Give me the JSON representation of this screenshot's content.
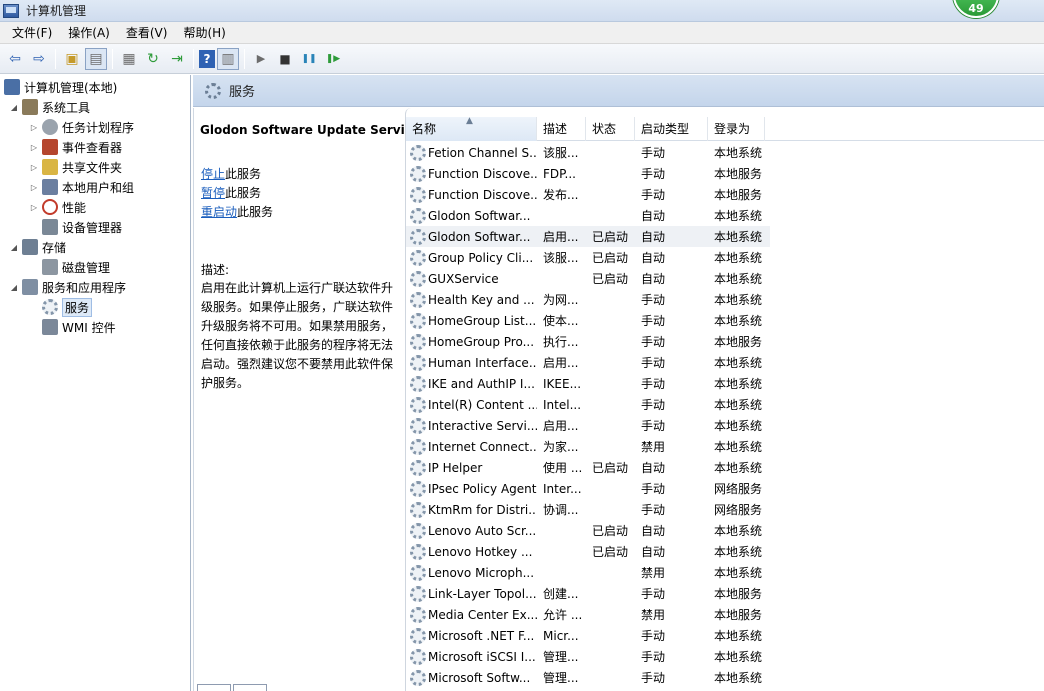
{
  "window": {
    "title": "计算机管理",
    "badge": "49"
  },
  "menu": [
    "文件(F)",
    "操作(A)",
    "查看(V)",
    "帮助(H)"
  ],
  "toolbar": [
    {
      "icon": "back-arrow-icon",
      "glyph": "⇦"
    },
    {
      "icon": "forward-arrow-icon",
      "glyph": "⇨"
    },
    {
      "icon": "folder-up-icon",
      "glyph": "▣"
    },
    {
      "icon": "console-tree-icon",
      "glyph": "▤"
    },
    {
      "icon": "properties-icon",
      "glyph": "▦"
    },
    {
      "icon": "refresh-icon",
      "glyph": "↻"
    },
    {
      "icon": "export-list-icon",
      "glyph": "⇥"
    },
    {
      "icon": "help-icon",
      "glyph": "?"
    },
    {
      "icon": "action-pane-icon",
      "glyph": "▥"
    },
    {
      "icon": "start-service-icon",
      "glyph": "▶"
    },
    {
      "icon": "stop-service-icon",
      "glyph": "■"
    },
    {
      "icon": "pause-service-icon",
      "glyph": "❚❚"
    },
    {
      "icon": "restart-service-icon",
      "glyph": "❚▶"
    }
  ],
  "tree": [
    {
      "label": "计算机管理(本地)",
      "icon": "computer-management-icon",
      "color": "#4a6fa5",
      "arrow": ""
    },
    {
      "label": "系统工具",
      "icon": "system-tools-icon",
      "color": "#8a7a5a",
      "arrow": "◢"
    },
    {
      "label": "任务计划程序",
      "icon": "task-scheduler-icon",
      "color": "#9aa3ad",
      "arrow": "▷"
    },
    {
      "label": "事件查看器",
      "icon": "event-viewer-icon",
      "color": "#b5462e",
      "arrow": "▷"
    },
    {
      "label": "共享文件夹",
      "icon": "shared-folders-icon",
      "color": "#d9b544",
      "arrow": "▷"
    },
    {
      "label": "本地用户和组",
      "icon": "local-users-groups-icon",
      "color": "#6b7fa0",
      "arrow": "▷"
    },
    {
      "label": "性能",
      "icon": "performance-icon",
      "color": "#c23b2b",
      "arrow": "▷"
    },
    {
      "label": "设备管理器",
      "icon": "device-manager-icon",
      "color": "#7a8896",
      "arrow": ""
    },
    {
      "label": "存储",
      "icon": "storage-icon",
      "color": "#6e7f93",
      "arrow": "◢"
    },
    {
      "label": "磁盘管理",
      "icon": "disk-management-icon",
      "color": "#8c96a1",
      "arrow": ""
    },
    {
      "label": "服务和应用程序",
      "icon": "services-applications-icon",
      "color": "#7f8fa3",
      "arrow": "◢"
    },
    {
      "label": "服务",
      "icon": "services-gear-icon",
      "color": "#9aa8b8",
      "arrow": ""
    },
    {
      "label": "WMI 控件",
      "icon": "wmi-control-icon",
      "color": "#7b8899",
      "arrow": ""
    }
  ],
  "header": {
    "title": "服务"
  },
  "detail": {
    "service_name": "Glodon Software Update Service",
    "actions": [
      {
        "link": "停止",
        "rest": "此服务"
      },
      {
        "link": "暂停",
        "rest": "此服务"
      },
      {
        "link": "重启动",
        "rest": "此服务"
      }
    ],
    "desc_label": "描述:",
    "description": "启用在此计算机上运行广联达软件升级服务。如果停止服务，广联达软件升级服务将不可用。如果禁用服务，任何直接依赖于此服务的程序将无法启动。强烈建议您不要禁用此软件保护服务。"
  },
  "columns": [
    "名称",
    "描述",
    "状态",
    "启动类型",
    "登录为"
  ],
  "services": [
    {
      "name": "Fetion Channel S...",
      "desc": "该服...",
      "status": "",
      "start": "手动",
      "logon": "本地系统"
    },
    {
      "name": "Function Discove...",
      "desc": "FDP...",
      "status": "",
      "start": "手动",
      "logon": "本地服务"
    },
    {
      "name": "Function Discove...",
      "desc": "发布...",
      "status": "",
      "start": "手动",
      "logon": "本地服务"
    },
    {
      "name": "Glodon Softwar...",
      "desc": "",
      "status": "",
      "start": "自动",
      "logon": "本地系统"
    },
    {
      "name": "Glodon Softwar...",
      "desc": "启用...",
      "status": "已启动",
      "start": "自动",
      "logon": "本地系统"
    },
    {
      "name": "Group Policy Cli...",
      "desc": "该服...",
      "status": "已启动",
      "start": "自动",
      "logon": "本地系统"
    },
    {
      "name": "GUXService",
      "desc": "",
      "status": "已启动",
      "start": "自动",
      "logon": "本地系统"
    },
    {
      "name": "Health Key and ...",
      "desc": "为网...",
      "status": "",
      "start": "手动",
      "logon": "本地系统"
    },
    {
      "name": "HomeGroup List...",
      "desc": "使本...",
      "status": "",
      "start": "手动",
      "logon": "本地系统"
    },
    {
      "name": "HomeGroup Pro...",
      "desc": "执行...",
      "status": "",
      "start": "手动",
      "logon": "本地服务"
    },
    {
      "name": "Human Interface...",
      "desc": "启用...",
      "status": "",
      "start": "手动",
      "logon": "本地系统"
    },
    {
      "name": "IKE and AuthIP I...",
      "desc": "IKEE...",
      "status": "",
      "start": "手动",
      "logon": "本地系统"
    },
    {
      "name": "Intel(R) Content ...",
      "desc": "Intel...",
      "status": "",
      "start": "手动",
      "logon": "本地系统"
    },
    {
      "name": "Interactive Servi...",
      "desc": "启用...",
      "status": "",
      "start": "手动",
      "logon": "本地系统"
    },
    {
      "name": "Internet Connect...",
      "desc": "为家...",
      "status": "",
      "start": "禁用",
      "logon": "本地系统"
    },
    {
      "name": "IP Helper",
      "desc": "使用 ...",
      "status": "已启动",
      "start": "自动",
      "logon": "本地系统"
    },
    {
      "name": "IPsec Policy Agent",
      "desc": "Inter...",
      "status": "",
      "start": "手动",
      "logon": "网络服务"
    },
    {
      "name": "KtmRm for Distri...",
      "desc": "协调...",
      "status": "",
      "start": "手动",
      "logon": "网络服务"
    },
    {
      "name": "Lenovo Auto Scr...",
      "desc": "",
      "status": "已启动",
      "start": "自动",
      "logon": "本地系统"
    },
    {
      "name": "Lenovo Hotkey ...",
      "desc": "",
      "status": "已启动",
      "start": "自动",
      "logon": "本地系统"
    },
    {
      "name": "Lenovo Microph...",
      "desc": "",
      "status": "",
      "start": "禁用",
      "logon": "本地系统"
    },
    {
      "name": "Link-Layer Topol...",
      "desc": "创建...",
      "status": "",
      "start": "手动",
      "logon": "本地服务"
    },
    {
      "name": "Media Center Ex...",
      "desc": "允许 ...",
      "status": "",
      "start": "禁用",
      "logon": "本地服务"
    },
    {
      "name": "Microsoft .NET F...",
      "desc": "Micr...",
      "status": "",
      "start": "手动",
      "logon": "本地系统"
    },
    {
      "name": "Microsoft iSCSI I...",
      "desc": "管理...",
      "status": "",
      "start": "手动",
      "logon": "本地系统"
    },
    {
      "name": "Microsoft Softw...",
      "desc": "管理...",
      "status": "",
      "start": "手动",
      "logon": "本地系统"
    }
  ]
}
